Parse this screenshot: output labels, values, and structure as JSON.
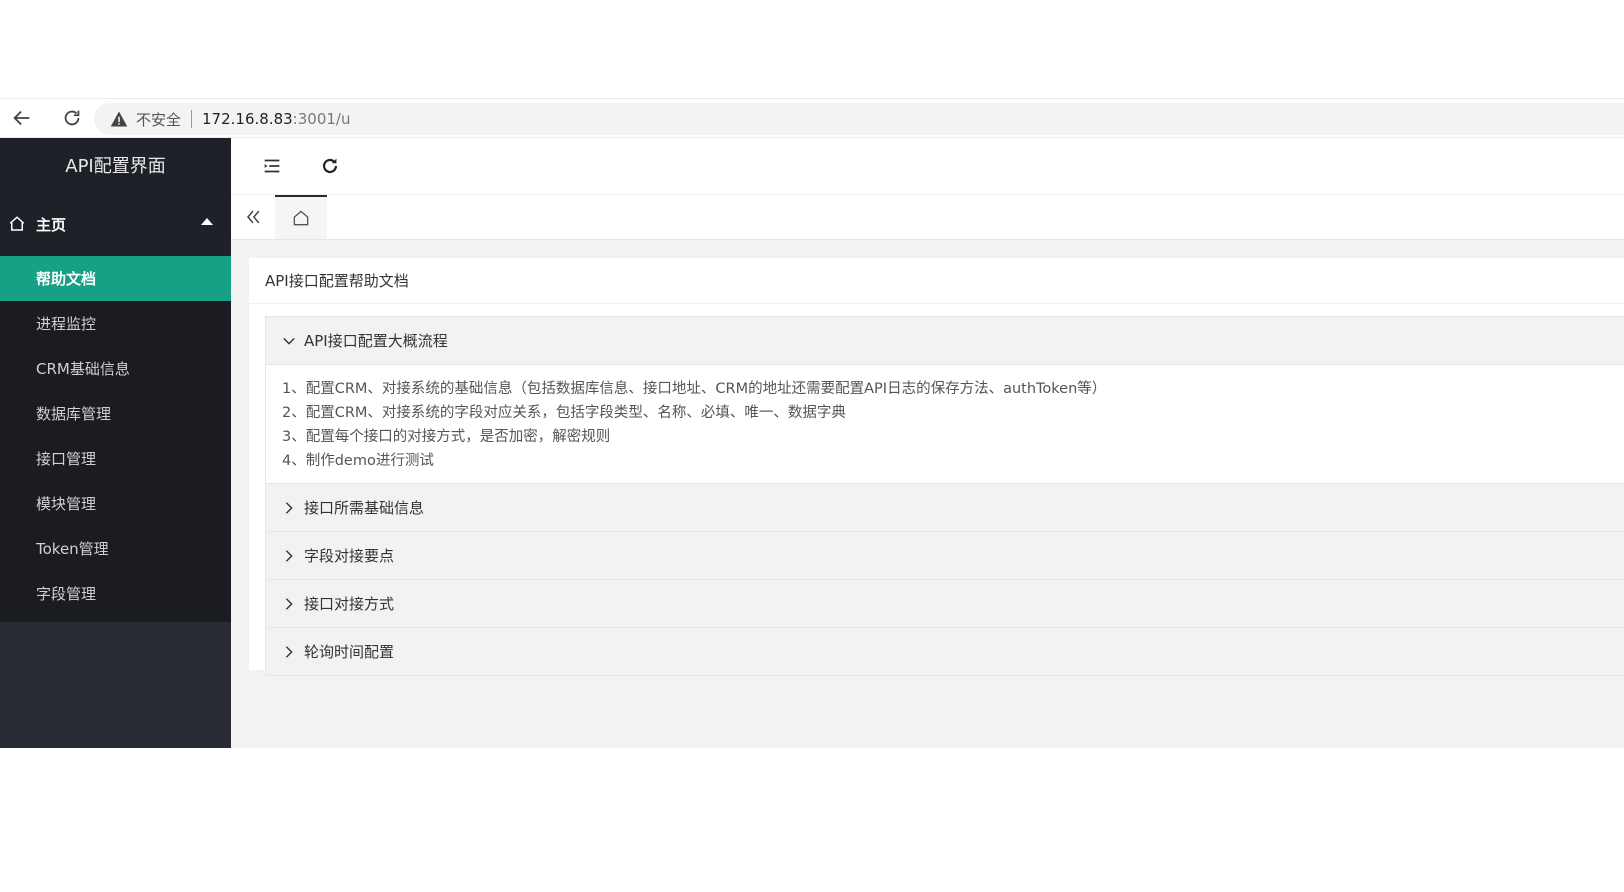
{
  "browser": {
    "insecure_label": "不安全",
    "url_host": "172.16.8.83",
    "url_rest": ":3001/u"
  },
  "sidebar": {
    "brand": "API配置界面",
    "home_label": "主页",
    "items": [
      {
        "label": "帮助文档",
        "active": true
      },
      {
        "label": "进程监控"
      },
      {
        "label": "CRM基础信息"
      },
      {
        "label": "数据库管理"
      },
      {
        "label": "接口管理"
      },
      {
        "label": "模块管理"
      },
      {
        "label": "Token管理"
      },
      {
        "label": "字段管理"
      }
    ]
  },
  "colors": {
    "sidebar_bg": "#282b33",
    "active_item": "#16a085",
    "content_bg": "#f2f2f2"
  },
  "content": {
    "card_title": "API接口配置帮助文档",
    "sections": [
      {
        "title": "API接口配置大概流程",
        "expanded": true,
        "lines": [
          "1、配置CRM、对接系统的基础信息（包括数据库信息、接口地址、CRM的地址还需要配置API日志的保存方法、authToken等）",
          "2、配置CRM、对接系统的字段对应关系，包括字段类型、名称、必填、唯一、数据字典",
          "3、配置每个接口的对接方式，是否加密，解密规则",
          "4、制作demo进行测试"
        ]
      },
      {
        "title": "接口所需基础信息",
        "expanded": false
      },
      {
        "title": "字段对接要点",
        "expanded": false
      },
      {
        "title": "接口对接方式",
        "expanded": false
      },
      {
        "title": "轮询时间配置",
        "expanded": false
      }
    ]
  }
}
